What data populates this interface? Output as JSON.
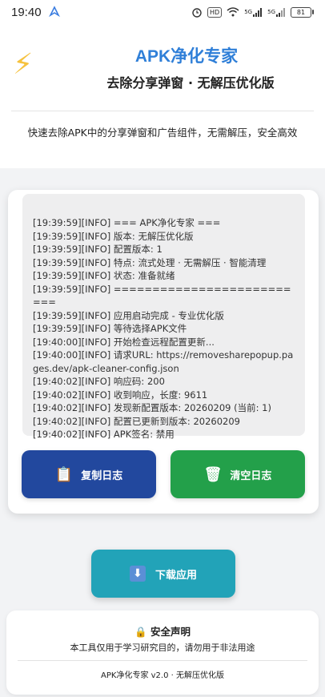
{
  "status_bar": {
    "time": "19:40",
    "hd_badge": "HD",
    "signal1": "5G",
    "signal2": "5G",
    "battery": "81"
  },
  "header": {
    "logo_icon": "lightning-bolt",
    "title": "APK净化专家",
    "subtitle": "去除分享弹窗 · 无解压优化版",
    "description": "快速去除APK中的分享弹窗和广告组件，无需解压，安全高效"
  },
  "log": {
    "lines": [
      "[19:39:59][INFO] === APK净化专家 ===",
      "[19:39:59][INFO] 版本: 无解压优化版",
      "[19:39:59][INFO] 配置版本: 1",
      "[19:39:59][INFO] 特点: 流式处理 · 无需解压 · 智能清理",
      "[19:39:59][INFO] 状态: 准备就绪",
      "[19:39:59][INFO] ==========================",
      "[19:39:59][INFO] 应用启动完成 - 专业优化版",
      "[19:39:59][INFO] 等待选择APK文件",
      "[19:40:00][INFO] 开始检查远程配置更新...",
      "[19:40:00][INFO] 请求URL: https://removesharepopup.pages.dev/apk-cleaner-config.json",
      "[19:40:02][INFO] 响应码: 200",
      "[19:40:02][INFO] 收到响应，长度: 9611",
      "[19:40:02][INFO] 发现新配置版本: 20260209 (当前: 1)",
      "[19:40:02][INFO] 配置已更新到版本: 20260209",
      "[19:40:02][INFO] APK签名: 禁用"
    ]
  },
  "buttons": {
    "copy_label": "复制日志",
    "copy_icon": "clipboard-icon",
    "clear_label": "清空日志",
    "clear_icon": "trash-icon",
    "download_label": "下载应用",
    "download_icon": "download-arrow-icon"
  },
  "footer": {
    "security_title": "🔒 安全声明",
    "security_text": "本工具仅用于学习研究目的，请勿用于非法用途",
    "version": "APK净化专家 v2.0 · 无解压优化版"
  },
  "colors": {
    "title": "#2f7fd8",
    "copy_button": "#22489e",
    "clear_button": "#23a04a",
    "download_button": "#22a3b8"
  }
}
